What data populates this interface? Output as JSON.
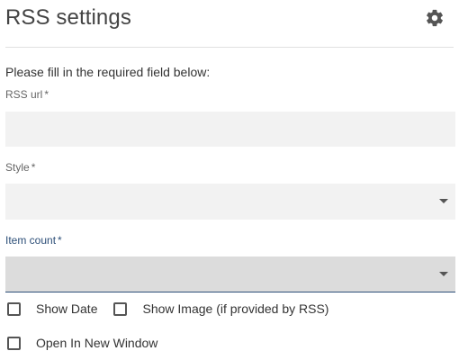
{
  "header": {
    "title": "RSS settings",
    "settings_icon": "gear-icon"
  },
  "form": {
    "intro": "Please fill in the required field below:",
    "rss_url": {
      "label": "RSS url",
      "required_mark": "*",
      "value": ""
    },
    "style": {
      "label": "Style",
      "required_mark": "*",
      "value": ""
    },
    "item_count": {
      "label": "Item count",
      "required_mark": "*",
      "value": ""
    },
    "checkboxes": {
      "show_date": {
        "label": "Show Date",
        "checked": false
      },
      "show_image": {
        "label": "Show Image (if provided by RSS)",
        "checked": false
      },
      "open_new_window": {
        "label": "Open In New Window",
        "checked": false
      }
    }
  },
  "colors": {
    "accent": "#2d4f78",
    "field_bg": "#f2f2f2",
    "field_focused_bg": "#dcdcdc"
  }
}
